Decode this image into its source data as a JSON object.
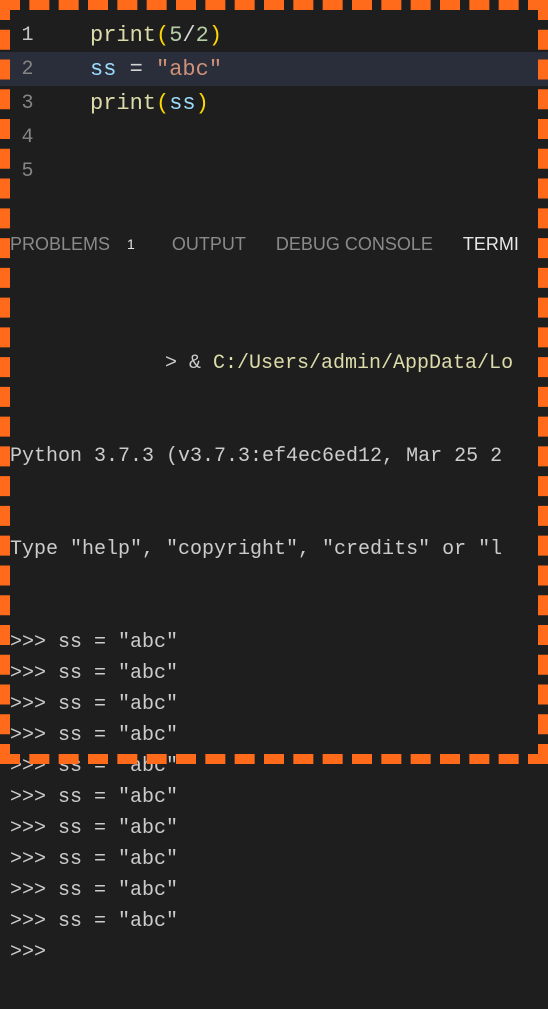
{
  "editor": {
    "lines": [
      {
        "num": "1",
        "active": true,
        "highlighted": false,
        "tokens": [
          {
            "cls": "tok-func",
            "t": "print"
          },
          {
            "cls": "tok-paren",
            "t": "("
          },
          {
            "cls": "tok-num",
            "t": "5"
          },
          {
            "cls": "tok-op",
            "t": "/"
          },
          {
            "cls": "tok-num",
            "t": "2"
          },
          {
            "cls": "tok-paren",
            "t": ")"
          }
        ]
      },
      {
        "num": "2",
        "active": false,
        "highlighted": true,
        "tokens": [
          {
            "cls": "tok-var",
            "t": "ss"
          },
          {
            "cls": "tok-eq",
            "t": " = "
          },
          {
            "cls": "tok-str",
            "t": "\"abc\""
          }
        ]
      },
      {
        "num": "3",
        "active": false,
        "highlighted": false,
        "tokens": [
          {
            "cls": "tok-func",
            "t": "print"
          },
          {
            "cls": "tok-paren",
            "t": "("
          },
          {
            "cls": "tok-var",
            "t": "ss"
          },
          {
            "cls": "tok-paren",
            "t": ")"
          }
        ]
      },
      {
        "num": "4",
        "active": false,
        "highlighted": false,
        "tokens": []
      },
      {
        "num": "5",
        "active": false,
        "highlighted": false,
        "tokens": []
      }
    ]
  },
  "panel": {
    "tabs": {
      "problems": "PROBLEMS",
      "problems_count": "1",
      "output": "OUTPUT",
      "debug": "DEBUG CONSOLE",
      "terminal": "TERMI"
    }
  },
  "terminal": {
    "cmd_prefix": "> & ",
    "cmd_path": "C:/Users/admin/AppData/Lo",
    "version": "Python 3.7.3 (v3.7.3:ef4ec6ed12, Mar 25 2",
    "help": "Type \"help\", \"copyright\", \"credits\" or \"l",
    "repl_lines": [
      ">>> ss = \"abc\"",
      ">>> ss = \"abc\"",
      ">>> ss = \"abc\"",
      ">>> ss = \"abc\"",
      ">>> ss = \"abc\"",
      ">>> ss = \"abc\"",
      ">>> ss = \"abc\"",
      ">>> ss = \"abc\"",
      ">>> ss = \"abc\"",
      ">>> ss = \"abc\"",
      ">>>"
    ]
  }
}
